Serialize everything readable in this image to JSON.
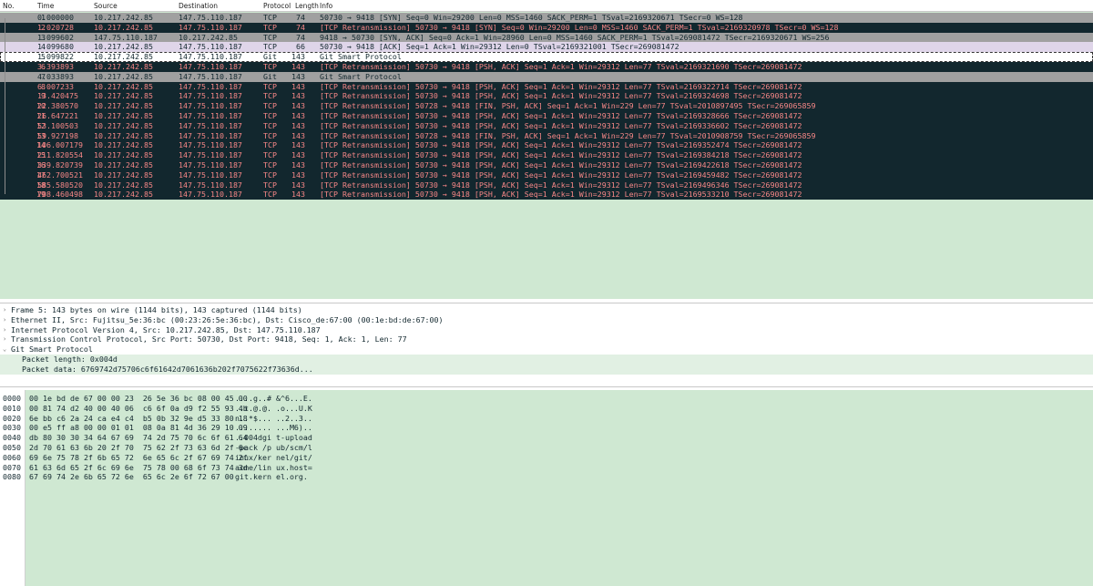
{
  "columns": {
    "no": "No.",
    "time": "Time",
    "source": "Source",
    "destination": "Destination",
    "protocol": "Protocol",
    "length": "Length",
    "info": "Info"
  },
  "packets": [
    {
      "no": "1",
      "time": "0.000000",
      "src": "10.217.242.85",
      "dst": "147.75.110.187",
      "proto": "TCP",
      "len": "74",
      "info": "50730 → 9418 [SYN] Seq=0 Win=29200 Len=0 MSS=1460 SACK_PERM=1 TSval=2169320671 TSecr=0 WS=128",
      "style": "syn"
    },
    {
      "no": "2",
      "time": "1.020728",
      "src": "10.217.242.85",
      "dst": "147.75.110.187",
      "proto": "TCP",
      "len": "74",
      "info": "[TCP Retransmission] 50730 → 9418 [SYN] Seq=0 Win=29200 Len=0 MSS=1460 SACK_PERM=1 TSval=2169320978 TSecr=0 WS=128",
      "style": "bad"
    },
    {
      "no": "3",
      "time": "1.099602",
      "src": "147.75.110.187",
      "dst": "10.217.242.85",
      "proto": "TCP",
      "len": "74",
      "info": "9418 → 50730 [SYN, ACK] Seq=0 Ack=1 Win=28960 Len=0 MSS=1460 SACK_PERM=1 TSval=269081472 TSecr=2169320671 WS=256",
      "style": "syn"
    },
    {
      "no": "4",
      "time": "1.099680",
      "src": "10.217.242.85",
      "dst": "147.75.110.187",
      "proto": "TCP",
      "len": "66",
      "info": "50730 → 9418 [ACK] Seq=1 Ack=1 Win=29312 Len=0 TSval=2169321001 TSecr=269081472",
      "style": "sel"
    },
    {
      "no": "5",
      "time": "1.099822",
      "src": "10.217.242.85",
      "dst": "147.75.110.187",
      "proto": "Git",
      "len": "143",
      "info": "Git Smart Protocol",
      "style": "plain"
    },
    {
      "no": "6",
      "time": "3.393893",
      "src": "10.217.242.85",
      "dst": "147.75.110.187",
      "proto": "TCP",
      "len": "143",
      "info": "[TCP Retransmission] 50730 → 9418 [PSH, ACK] Seq=1 Ack=1 Win=29312 Len=77 TSval=2169321690 TSecr=269081472",
      "style": "bad"
    },
    {
      "no": "7",
      "time": "4.033893",
      "src": "10.217.242.85",
      "dst": "147.75.110.187",
      "proto": "Git",
      "len": "143",
      "info": "Git Smart Protocol",
      "style": "git"
    },
    {
      "no": "8",
      "time": "6.007233",
      "src": "10.217.242.85",
      "dst": "147.75.110.187",
      "proto": "TCP",
      "len": "143",
      "info": "[TCP Retransmission] 50730 → 9418 [PSH, ACK] Seq=1 Ack=1 Win=29312 Len=77 TSval=2169322714 TSecr=269081472",
      "style": "bad"
    },
    {
      "no": "9",
      "time": "13.420475",
      "src": "10.217.242.85",
      "dst": "147.75.110.187",
      "proto": "TCP",
      "len": "143",
      "info": "[TCP Retransmission] 50730 → 9418 [PSH, ACK] Seq=1 Ack=1 Win=29312 Len=77 TSval=2169324698 TSecr=269081472",
      "style": "bad"
    },
    {
      "no": "10",
      "time": "22.380570",
      "src": "10.217.242.85",
      "dst": "147.75.110.187",
      "proto": "TCP",
      "len": "143",
      "info": "[TCP Retransmission] 50728 → 9418 [FIN, PSH, ACK] Seq=1 Ack=1 Win=229 Len=77 TSval=2010897495 TSecr=269065859",
      "style": "bad"
    },
    {
      "no": "11",
      "time": "26.647221",
      "src": "10.217.242.85",
      "dst": "147.75.110.187",
      "proto": "TCP",
      "len": "143",
      "info": "[TCP Retransmission] 50730 → 9418 [PSH, ACK] Seq=1 Ack=1 Win=29312 Len=77 TSval=2169328666 TSecr=269081472",
      "style": "bad"
    },
    {
      "no": "12",
      "time": "53.100503",
      "src": "10.217.242.85",
      "dst": "147.75.110.187",
      "proto": "TCP",
      "len": "143",
      "info": "[TCP Retransmission] 50730 → 9418 [PSH, ACK] Seq=1 Ack=1 Win=29312 Len=77 TSval=2169336602 TSecr=269081472",
      "style": "bad"
    },
    {
      "no": "13",
      "time": "59.927198",
      "src": "10.217.242.85",
      "dst": "147.75.110.187",
      "proto": "TCP",
      "len": "143",
      "info": "[TCP Retransmission] 50728 → 9418 [FIN, PSH, ACK] Seq=1 Ack=1 Win=229 Len=77 TSval=2010908759 TSecr=269065859",
      "style": "bad"
    },
    {
      "no": "14",
      "time": "106.007179",
      "src": "10.217.242.85",
      "dst": "147.75.110.187",
      "proto": "TCP",
      "len": "143",
      "info": "[TCP Retransmission] 50730 → 9418 [PSH, ACK] Seq=1 Ack=1 Win=29312 Len=77 TSval=2169352474 TSecr=269081472",
      "style": "bad"
    },
    {
      "no": "15",
      "time": "211.820554",
      "src": "10.217.242.85",
      "dst": "147.75.110.187",
      "proto": "TCP",
      "len": "143",
      "info": "[TCP Retransmission] 50730 → 9418 [PSH, ACK] Seq=1 Ack=1 Win=29312 Len=77 TSval=2169384218 TSecr=269081472",
      "style": "bad"
    },
    {
      "no": "16",
      "time": "339.820739",
      "src": "10.217.242.85",
      "dst": "147.75.110.187",
      "proto": "TCP",
      "len": "143",
      "info": "[TCP Retransmission] 50730 → 9418 [PSH, ACK] Seq=1 Ack=1 Win=29312 Len=77 TSval=2169422618 TSecr=269081472",
      "style": "bad"
    },
    {
      "no": "17",
      "time": "462.700521",
      "src": "10.217.242.85",
      "dst": "147.75.110.187",
      "proto": "TCP",
      "len": "143",
      "info": "[TCP Retransmission] 50730 → 9418 [PSH, ACK] Seq=1 Ack=1 Win=29312 Len=77 TSval=2169459482 TSecr=269081472",
      "style": "bad"
    },
    {
      "no": "18",
      "time": "585.580520",
      "src": "10.217.242.85",
      "dst": "147.75.110.187",
      "proto": "TCP",
      "len": "143",
      "info": "[TCP Retransmission] 50730 → 9418 [PSH, ACK] Seq=1 Ack=1 Win=29312 Len=77 TSval=2169496346 TSecr=269081472",
      "style": "bad"
    },
    {
      "no": "19",
      "time": "708.460498",
      "src": "10.217.242.85",
      "dst": "147.75.110.187",
      "proto": "TCP",
      "len": "143",
      "info": "[TCP Retransmission] 50730 → 9418 [PSH, ACK] Seq=1 Ack=1 Win=29312 Len=77 TSval=2169533210 TSecr=269081472",
      "style": "bad"
    }
  ],
  "details": [
    {
      "text": "Frame 5: 143 bytes on wire (1144 bits), 143 captured (1144 bits)",
      "expanded": false,
      "child": false
    },
    {
      "text": "Ethernet II, Src: Fujitsu_5e:36:bc (00:23:26:5e:36:bc), Dst: Cisco_de:67:00 (00:1e:bd:de:67:00)",
      "expanded": false,
      "child": false
    },
    {
      "text": "Internet Protocol Version 4, Src: 10.217.242.85, Dst: 147.75.110.187",
      "expanded": false,
      "child": false
    },
    {
      "text": "Transmission Control Protocol, Src Port: 50730, Dst Port: 9418, Seq: 1, Ack: 1, Len: 77",
      "expanded": false,
      "child": false
    },
    {
      "text": "Git Smart Protocol",
      "expanded": true,
      "child": false
    },
    {
      "text": "Packet length: 0x004d",
      "expanded": false,
      "child": true
    },
    {
      "text": "Packet data: 6769742d75706c6f61642d7061636b202f7075622f73636d...",
      "expanded": false,
      "child": true
    }
  ],
  "bytes": [
    {
      "off": "0000",
      "hex": "00 1e bd de 67 00 00 23  26 5e 36 bc 08 00 45 00",
      "ascii": "....g..# &^6...E."
    },
    {
      "off": "0010",
      "hex": "00 81 74 d2 40 00 40 06  c6 6f 0a d9 f2 55 93 4b",
      "ascii": "..t.@.@. .o...U.K"
    },
    {
      "off": "0020",
      "hex": "6e bb c6 2a 24 ca e4 c4  b5 0b 32 9e d5 33 80 18",
      "ascii": "n..*$... ..2..3.."
    },
    {
      "off": "0030",
      "hex": "00 e5 ff a8 00 00 01 01  08 0a 81 4d 36 29 10 09",
      "ascii": "........ ...M6).."
    },
    {
      "off": "0040",
      "hex": "db 80 30 30 34 64 67 69  74 2d 75 70 6c 6f 61 64",
      "ascii": "..004dgi t-upload"
    },
    {
      "off": "0050",
      "hex": "2d 70 61 63 6b 20 2f 70  75 62 2f 73 63 6d 2f 6c",
      "ascii": "-pack /p ub/scm/l"
    },
    {
      "off": "0060",
      "hex": "69 6e 75 78 2f 6b 65 72  6e 65 6c 2f 67 69 74 2f",
      "ascii": "inux/ker nel/git/"
    },
    {
      "off": "0070",
      "hex": "61 63 6d 65 2f 6c 69 6e  75 78 00 68 6f 73 74 3d",
      "ascii": "acme/lin ux.host="
    },
    {
      "off": "0080",
      "hex": "67 69 74 2e 6b 65 72 6e  65 6c 2e 6f 72 67 00",
      "ascii": "git.kern el.org."
    }
  ],
  "colors": {
    "list_background": "#cfe8d2",
    "retransmission_bg": "#12272e",
    "retransmission_fg": "#f78787",
    "tcp_syn_bg": "#a0a0a0",
    "selected_bg": "#dfd5e9"
  },
  "icons": {
    "collapsed": "tree-collapsed-icon",
    "expanded": "tree-expanded-icon"
  }
}
